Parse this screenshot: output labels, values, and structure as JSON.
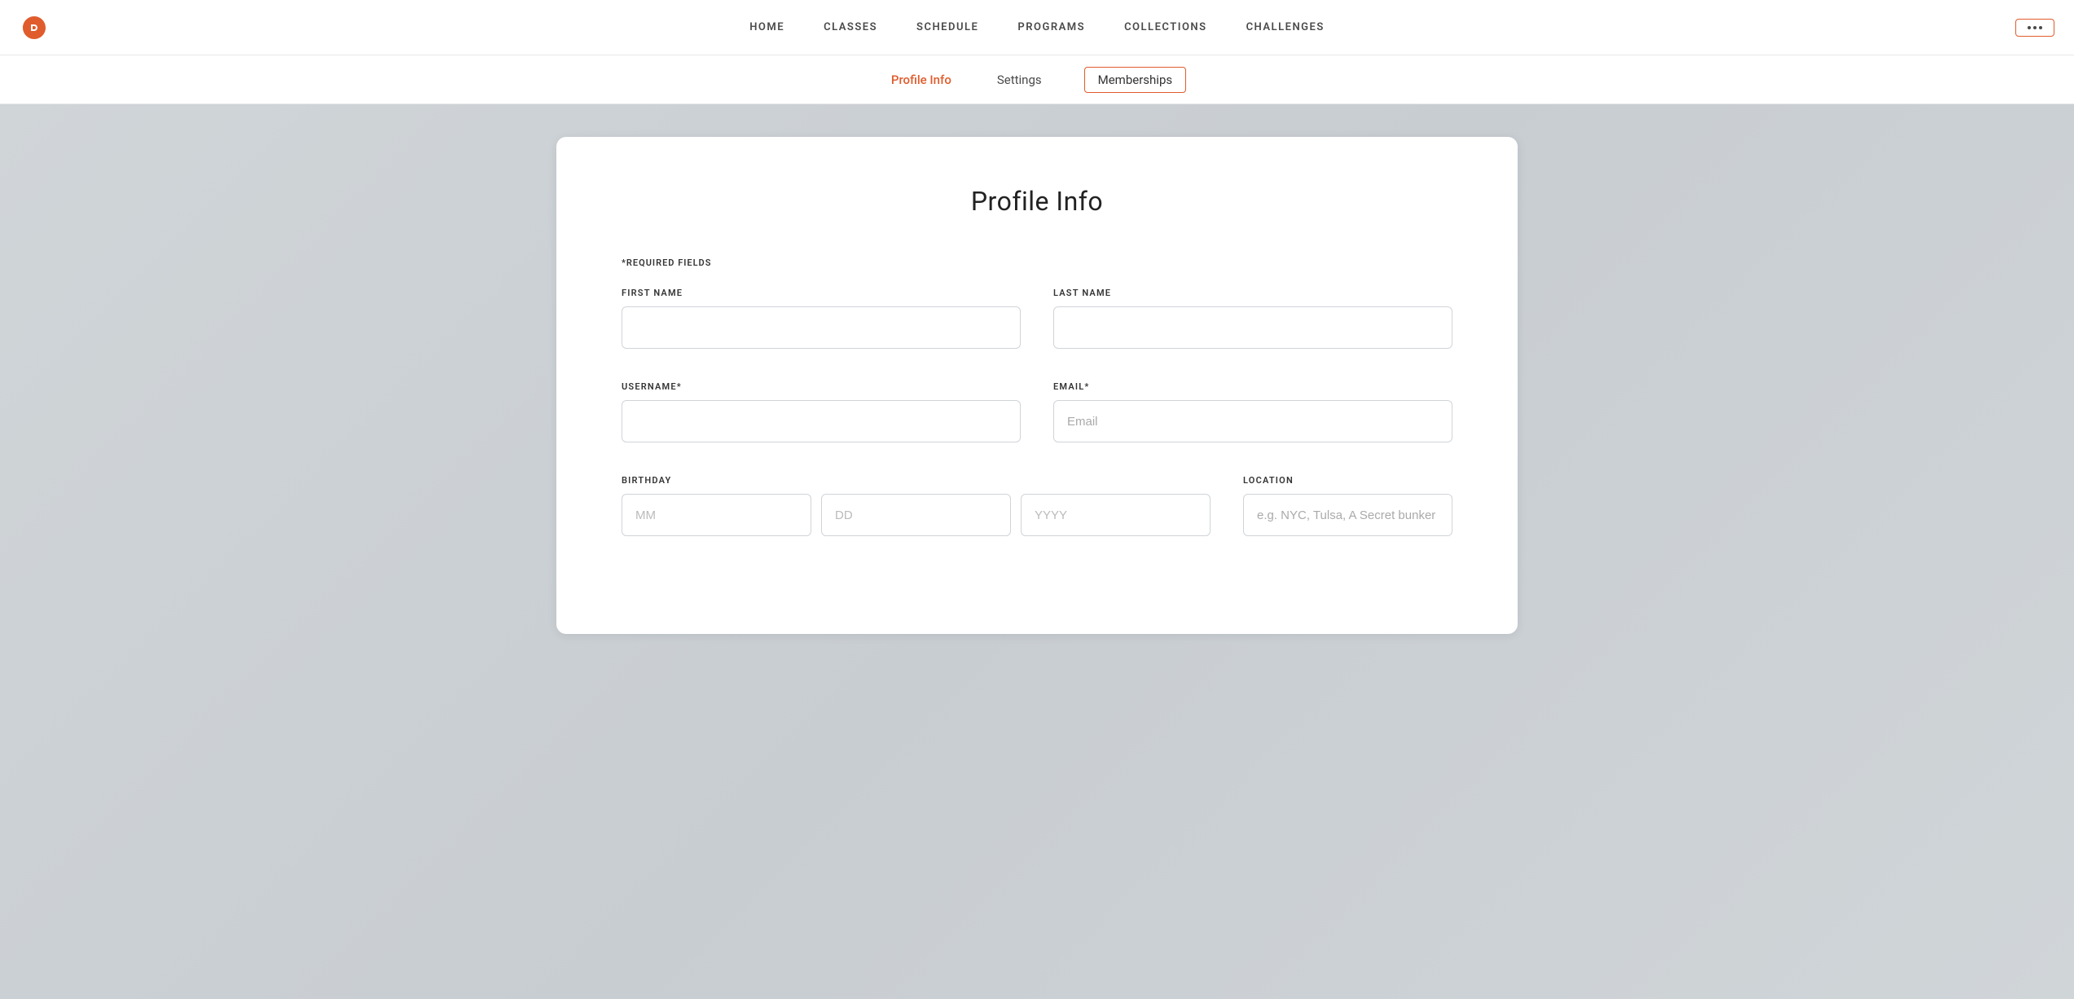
{
  "nav": {
    "links": [
      {
        "id": "home",
        "label": "HOME"
      },
      {
        "id": "classes",
        "label": "CLASSES"
      },
      {
        "id": "schedule",
        "label": "SCHEDULE"
      },
      {
        "id": "programs",
        "label": "PROGRAMS"
      },
      {
        "id": "collections",
        "label": "COLLECTIONS"
      },
      {
        "id": "challenges",
        "label": "CHALLENGES"
      }
    ],
    "more_button_label": "···"
  },
  "sub_nav": {
    "tabs": [
      {
        "id": "profile-info",
        "label": "Profile Info",
        "active": true,
        "outlined": false
      },
      {
        "id": "settings",
        "label": "Settings",
        "active": false,
        "outlined": false
      },
      {
        "id": "memberships",
        "label": "Memberships",
        "active": false,
        "outlined": true
      }
    ]
  },
  "form": {
    "title": "Profile Info",
    "required_note": "*REQUIRED FIELDS",
    "fields": {
      "first_name_label": "FIRST NAME",
      "last_name_label": "LAST NAME",
      "username_label": "USERNAME*",
      "email_label": "EMAIL*",
      "email_placeholder": "Email",
      "birthday_label": "BIRTHDAY",
      "location_label": "LOCATION",
      "birthday_mm_placeholder": "MM",
      "birthday_dd_placeholder": "DD",
      "birthday_yyyy_placeholder": "YYYY",
      "location_placeholder": "e.g. NYC, Tulsa, A Secret bunker"
    }
  }
}
